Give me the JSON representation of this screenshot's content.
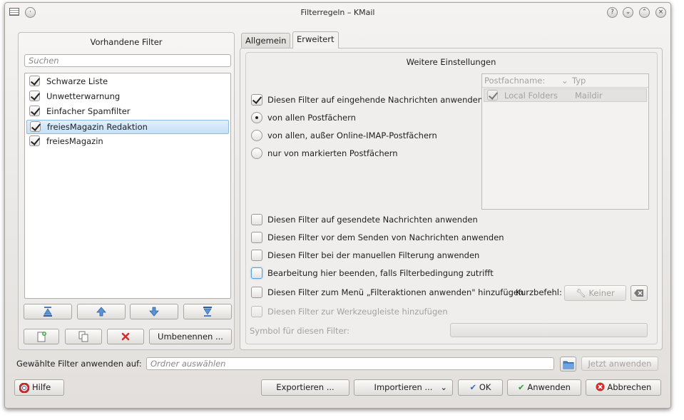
{
  "window": {
    "title": "Filterregeln – KMail",
    "controls": [
      "help-icon",
      "minimize-icon",
      "maximize-icon",
      "close-icon"
    ]
  },
  "left": {
    "heading": "Vorhandene Filter",
    "search_placeholder": "Suchen",
    "filters": [
      {
        "label": "Schwarze Liste",
        "checked": true,
        "selected": false
      },
      {
        "label": "Unwetterwarnung",
        "checked": true,
        "selected": false
      },
      {
        "label": "Einfacher Spamfilter",
        "checked": true,
        "selected": false
      },
      {
        "label": "freiesMagazin Redaktion",
        "checked": true,
        "selected": true
      },
      {
        "label": "freiesMagazin",
        "checked": true,
        "selected": false
      }
    ],
    "rename_label": "Umbenennen ..."
  },
  "tabs": [
    {
      "label": "Allgemein",
      "active": false
    },
    {
      "label": "Erweitert",
      "active": true
    }
  ],
  "advanced": {
    "heading": "Weitere Einstellungen",
    "incoming_label": "Diesen Filter auf eingehende Nachrichten anwenden",
    "radios": [
      {
        "label": "von allen Postfächern",
        "checked": true
      },
      {
        "label": "von allen, außer Online-IMAP-Postfächern",
        "checked": false
      },
      {
        "label": "nur von markierten Postfächern",
        "checked": false
      }
    ],
    "mailbox_table": {
      "col_name": "Postfachname:",
      "col_type": "Typ",
      "rows": [
        {
          "name": "Local Folders",
          "type": "Maildir"
        }
      ]
    },
    "sent_label": "Diesen Filter auf gesendete Nachrichten anwenden",
    "before_send_label": "Diesen Filter vor dem Senden von Nachrichten anwenden",
    "manual_label": "Diesen Filter bei der manuellen Filterung anwenden",
    "stop_label": "Bearbeitung hier beenden, falls Filterbedingung zutrifft",
    "menu_label": "Diesen Filter zum Menü „Filteraktionen anwenden\" hinzufügen",
    "shortcut_label": "Kurzbefehl:",
    "shortcut_value": "Keiner",
    "toolbar_label": "Diesen Filter zur Werkzeugleiste hinzufügen",
    "symbol_label": "Symbol für diesen Filter:"
  },
  "apply": {
    "label": "Gewählte Filter anwenden auf:",
    "folder_placeholder": "Ordner auswählen",
    "apply_now": "Jetzt anwenden"
  },
  "footer": {
    "help": "Hilfe",
    "export": "Exportieren ...",
    "import": "Importieren ...",
    "ok": "OK",
    "apply": "Anwenden",
    "cancel": "Abbrechen"
  }
}
